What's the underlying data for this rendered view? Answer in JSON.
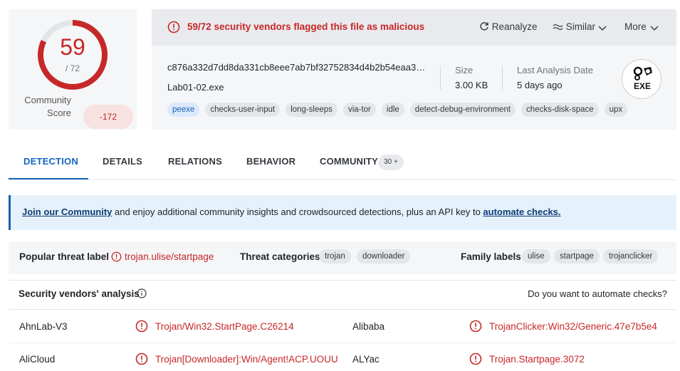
{
  "score": {
    "detections": "59",
    "total": "/ 72",
    "fraction": 0.8194,
    "community_label_line1": "Community",
    "community_label_line2": "Score",
    "community_score": "-172"
  },
  "header": {
    "alert": "59/72 security vendors flagged this file as malicious",
    "reanalyze": "Reanalyze",
    "similar": "Similar",
    "more": "More",
    "hash": "c876a332d7dd8da331cb8eee7ab7bf32752834d4b2b54eaa3…",
    "filename": "Lab01-02.exe",
    "size_label": "Size",
    "size_value": "3.00 KB",
    "last_analysis_label": "Last Analysis Date",
    "last_analysis_value": "5 days ago",
    "file_type": "EXE",
    "tags": [
      "peexe",
      "checks-user-input",
      "long-sleeps",
      "via-tor",
      "idle",
      "detect-debug-environment",
      "checks-disk-space",
      "upx"
    ]
  },
  "tabs": {
    "detection": "DETECTION",
    "details": "DETAILS",
    "relations": "RELATIONS",
    "behavior": "BEHAVIOR",
    "community": "COMMUNITY",
    "community_count": "30 +"
  },
  "banner": {
    "join": "Join our Community",
    "middle": " and enjoy additional community insights and crowdsourced detections, plus an API key to ",
    "automate": "automate checks."
  },
  "threat": {
    "popular_label": "Popular threat label",
    "popular_value": "trojan.ulise/startpage",
    "categories_label": "Threat categories",
    "categories": [
      "trojan",
      "downloader"
    ],
    "family_label": "Family labels",
    "families": [
      "ulise",
      "startpage",
      "trojanclicker"
    ]
  },
  "vendors": {
    "title": "Security vendors' analysis",
    "automate_question": "Do you want to automate checks?",
    "rows": [
      {
        "left_name": "AhnLab-V3",
        "left_result": "Trojan/Win32.StartPage.C26214",
        "right_name": "Alibaba",
        "right_result": "TrojanClicker:Win32/Generic.47e7b5e4"
      },
      {
        "left_name": "AliCloud",
        "left_result": "Trojan[Downloader]:Win/Agent!ACP.UOUU",
        "right_name": "ALYac",
        "right_result": "Trojan.Startpage.3072"
      }
    ]
  },
  "colors": {
    "malicious": "#c62828",
    "accent": "#1565c0"
  }
}
